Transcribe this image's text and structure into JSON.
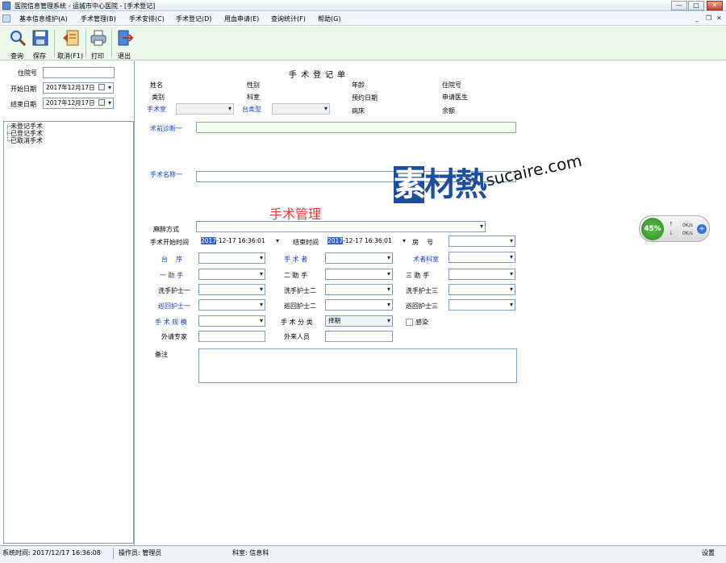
{
  "window": {
    "title": "医院信息管理系统  -  运城市中心医院 - [手术登记]",
    "minimize": "—",
    "maximize": "□",
    "close": "✕",
    "mdi_min": "_",
    "mdi_restore": "❐",
    "mdi_close": "✕"
  },
  "menu": [
    "基本信息维护(A)",
    "手术管理(B)",
    "手术安排(C)",
    "手术登记(D)",
    "用血申请(E)",
    "查询统计(F)",
    "帮助(G)"
  ],
  "toolbar": [
    {
      "label": "查询",
      "icon": "search-icon"
    },
    {
      "label": "保存",
      "icon": "save-icon"
    },
    {
      "label": "取消(F1)",
      "icon": "cancel-icon"
    },
    {
      "label": "打印",
      "icon": "print-icon"
    },
    {
      "label": "退出",
      "icon": "exit-icon"
    }
  ],
  "left": {
    "hospital_no_label": "住院号",
    "hospital_no_value": "",
    "start_label": "开始日期",
    "start_value": "2017年12月17日",
    "end_label": "结束日期",
    "end_value": "2017年12月17日",
    "tree": [
      "未登记手术",
      "已登记手术",
      "已取消手术"
    ]
  },
  "form": {
    "title": "手术登记单",
    "info": {
      "name": "姓名",
      "gender": "性别",
      "age": "年龄",
      "hospital_no": "住院号",
      "category": "类别",
      "department": "科室",
      "appoint_date": "预约日期",
      "apply_doctor": "申请医生",
      "room": "手术室",
      "table_type": "台类型",
      "bed": "病床",
      "balance": "余额"
    },
    "preop_label": "术前诊断一",
    "surgery_name_label": "手术名称一",
    "anesthesia_label": "麻醉方式",
    "start_time_label": "手术开始时间",
    "start_time_hl": "2017",
    "start_time_rest": "-12-17 16:36:01",
    "end_time_label": "结束时间",
    "end_time_hl": "2017",
    "end_time_rest": "-12-17 16:36:01",
    "room_no_label": "房    号",
    "order_label": "台    序",
    "surgeon_label": "手 术 者",
    "surgeon_dept_label": "术者科室",
    "asst1_label": "一 助 手",
    "asst2_label": "二 助 手",
    "asst3_label": "三 助 手",
    "scrub1_label": "洗手护士一",
    "scrub2_label": "洗手护士二",
    "scrub3_label": "洗手护士三",
    "circ1_label": "巡回护士一",
    "circ2_label": "巡回护士二",
    "circ3_label": "巡回护士三",
    "scale_label": "手 术 规 模",
    "class_label": "手 术 分 类",
    "class_value": "择期",
    "infect_label": "感染",
    "ext_expert_label": "外请专家",
    "outside_label": "外来人员",
    "remark_label": "备注"
  },
  "watermark": {
    "cn_a": "素",
    "cn_b": "材熱",
    "en": "sucaire.com",
    "red": "手术管理"
  },
  "widget": {
    "percent": "45%",
    "up": "0K/s",
    "down": "0K/s",
    "plus": "+"
  },
  "status": {
    "time": "系统时间: 2017/12/17 16:36:08",
    "operator": "操作员: 管理员",
    "dept": "科室: 信息科",
    "settings": "设置"
  }
}
